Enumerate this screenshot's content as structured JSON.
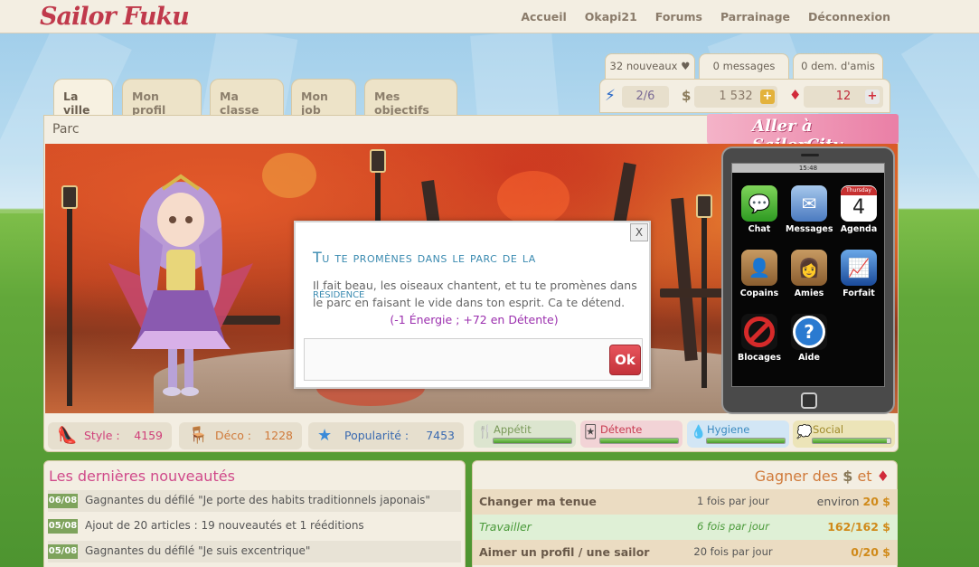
{
  "logo": "Sailor Fuku",
  "topnav": [
    "Accueil",
    "Okapi21",
    "Forums",
    "Parrainage",
    "Déconnexion"
  ],
  "tabs": [
    "La ville",
    "Mon profil",
    "Ma classe",
    "Mon job",
    "Mes objectifs"
  ],
  "message_tabs": [
    "32 nouveaux ♥",
    "0 messages",
    "0 dem. d'amis"
  ],
  "resources": {
    "energy": "2/6",
    "money": "1 532",
    "gems": "12"
  },
  "panel_title": "Parc",
  "aller_label": "Aller à SailorCity",
  "phone": {
    "time": "15:48",
    "calendar_day": "Thursday",
    "calendar_num": "4",
    "apps": [
      "Chat",
      "Messages",
      "Agenda",
      "Copains",
      "Amies",
      "Forfait",
      "Blocages",
      "Aide"
    ]
  },
  "popup": {
    "close": "X",
    "title_line1": "Tu te promènes dans le parc de la",
    "title_line2": "résidence",
    "text": "Il fait beau, les oiseaux chantent, et tu te promènes dans le parc en faisant le vide dans ton esprit. Ca te détend.",
    "effect": "(-1 Énergie ; +72 en Détente)",
    "ok": "Ok"
  },
  "stats": [
    {
      "name": "Style :",
      "value": "4159",
      "color": "#d0407a"
    },
    {
      "name": "Déco :",
      "value": "1228",
      "color": "#d07a3a"
    },
    {
      "name": "Popularité :",
      "value": "7453",
      "color": "#3a6ab0"
    }
  ],
  "gauges": [
    {
      "name": "Appétit",
      "level": 1.0,
      "color": "#7a9a5a",
      "bg": "#dce5cf"
    },
    {
      "name": "Détente",
      "level": 1.0,
      "color": "#c83a50",
      "bg": "#f2d3d6"
    },
    {
      "name": "Hygiene",
      "level": 1.0,
      "color": "#3a8ac0",
      "bg": "#d2e6f5"
    },
    {
      "name": "Social",
      "level": 0.95,
      "color": "#a08a2a",
      "bg": "#ece4b8"
    }
  ],
  "news": {
    "title": "Les dernières nouveautés",
    "items": [
      {
        "date": "06/08",
        "text": "Gagnantes du défilé \"Je porte des habits traditionnels japonais\""
      },
      {
        "date": "05/08",
        "text": "Ajout de 20 articles : 19 nouveautés et 1 rééditions"
      },
      {
        "date": "05/08",
        "text": "Gagnantes du défilé \"Je suis excentrique\""
      }
    ]
  },
  "gain": {
    "title_prefix": "Gagner des",
    "title_mid": "et",
    "rows": [
      {
        "action": "Changer ma tenue",
        "freq": "1 fois par jour",
        "reward_prefix": "environ",
        "reward": "20 $"
      },
      {
        "action": "Travailler",
        "freq": "6 fois par jour",
        "reward_prefix": "",
        "reward": "162/162 $"
      },
      {
        "action": "Aimer un profil / une sailor",
        "freq": "20 fois par jour",
        "reward_prefix": "",
        "reward": "0/20 $"
      }
    ]
  }
}
